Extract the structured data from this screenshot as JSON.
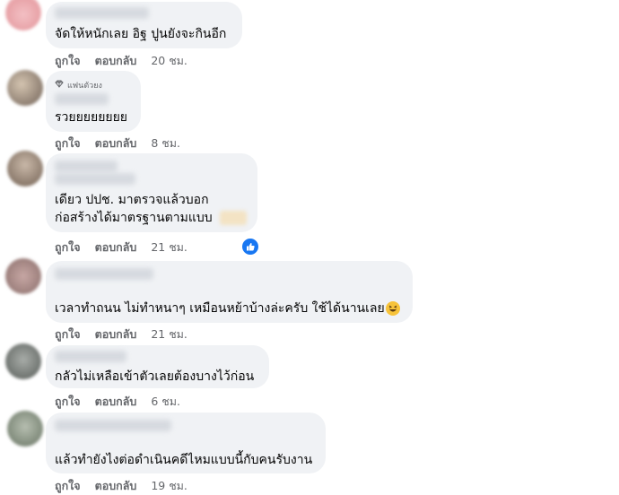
{
  "labels": {
    "like": "ถูกใจ",
    "reply": "ตอบกลับ"
  },
  "comments": [
    {
      "text": "จัดให้หนักเลย อิฐ ปูนยังจะกินอีก",
      "time": "20 ชม.",
      "avatar_color": "#e8b4b8"
    },
    {
      "badge": "แฟนตัวยง",
      "text": "รวยยยยยยยย",
      "time": "8 ชม.",
      "avatar_color": "#b9a99a"
    },
    {
      "text_line1": "เดียว ปปช. มาตรวจแล้วบอก",
      "text_line2": "ก่อสร้างได้มาตรฐานตามแบบ",
      "time": "21 ชม.",
      "avatar_color": "#a99a8c"
    },
    {
      "text": "เวลาทำถนน ไม่ทำหนาๆ เหมือนหย้าบ้างล่ะครับ ใช้ได้นานเลย",
      "time": "21 ชม.",
      "avatar_color": "#b89a98"
    },
    {
      "text": "กลัวไม่เหลือเข้าตัวเลยต้องบางไว้ก่อน",
      "time": "6 ชม.",
      "avatar_color": "#8f9590"
    },
    {
      "text": "แล้วทำยังไงต่อดำเนินคดีไหมแบบนี้กับคนรับงาน",
      "time": "19 ชม.",
      "avatar_color": "#9fa89c"
    }
  ],
  "colors": {
    "bubble": "#f0f2f5",
    "meta": "#65676b",
    "like_badge": "#1877f2"
  },
  "icons": {
    "badge_icon": "diamond-icon",
    "reaction": "like-reaction-icon",
    "emoji": "laughing-emoji-icon"
  }
}
